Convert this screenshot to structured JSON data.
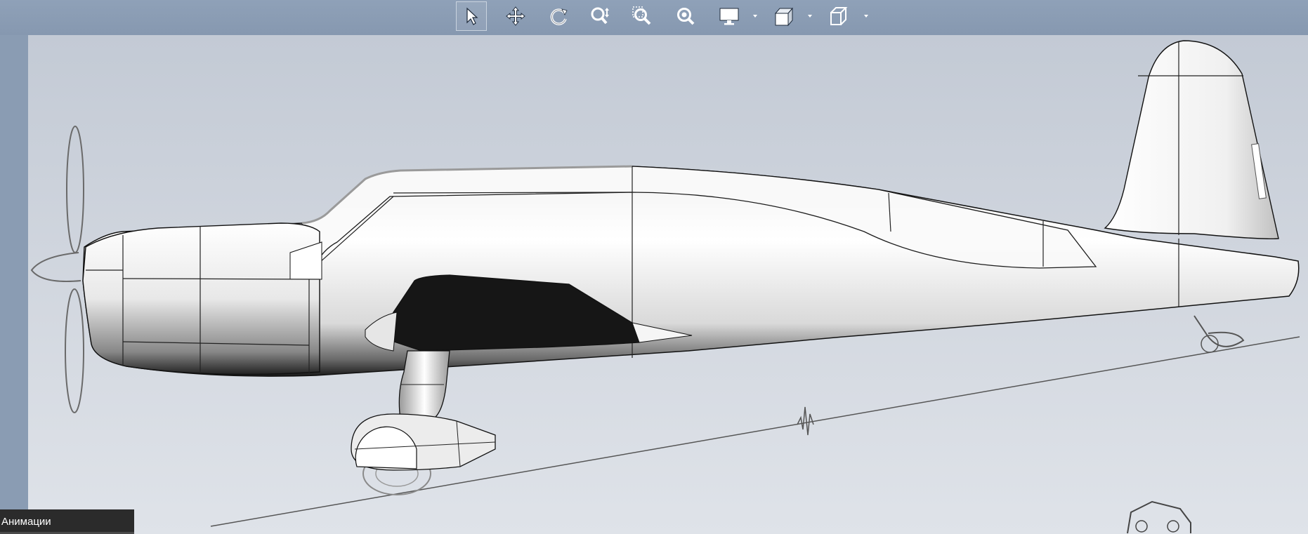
{
  "toolbar": {
    "tools": [
      {
        "name": "select-cursor-icon",
        "active": true
      },
      {
        "name": "pan-move-icon",
        "active": false
      },
      {
        "name": "rotate-icon",
        "active": false
      },
      {
        "name": "zoom-in-out-icon",
        "active": false
      },
      {
        "name": "zoom-to-area-icon",
        "active": false
      },
      {
        "name": "zoom-to-fit-icon",
        "active": false
      },
      {
        "name": "display-monitor-icon",
        "active": false,
        "dropdown": true
      },
      {
        "name": "view-orientation-icon",
        "active": false,
        "dropdown": true
      },
      {
        "name": "display-style-cube-icon",
        "active": false,
        "dropdown": true
      }
    ]
  },
  "viewport": {
    "model": "aircraft-side-view",
    "background_top": "#c3cad5",
    "background_bottom": "#dfe3e9"
  },
  "bottom_tabs": {
    "animations_label": "Анимации"
  },
  "colors": {
    "toolbar_bg": "#8b9db4",
    "tab_bg": "#2b2b2b",
    "tab_text": "#ffffff"
  }
}
